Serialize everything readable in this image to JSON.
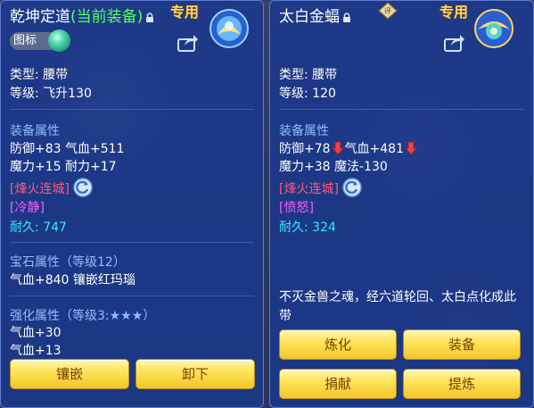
{
  "left_panel": {
    "title": "乾坤定道",
    "current_equip": "(当前装备)",
    "exclusive": "专用",
    "tag_label": "图标",
    "type_line": "类型: 腰带",
    "level_line": "等级: 飞升130",
    "attr_header": "装备属性",
    "attr_line1": "防御+83 气血+511",
    "attr_line2": "魔力+15 耐力+17",
    "special_skill": "[烽火连城]",
    "special_effect": "[冷静]",
    "durability": "耐久: 747",
    "gem_header": "宝石属性（等级12）",
    "gem_line": "气血+840 镶嵌红玛瑙",
    "enhance_header": "强化属性（等级3:★★★）",
    "enhance_line1": "气血+30",
    "enhance_line2": "气血+13",
    "buttons": {
      "inlay": "镶嵌",
      "unequip": "卸下"
    }
  },
  "right_panel": {
    "title": "太白金蝠",
    "exclusive": "专用",
    "type_line": "类型: 腰带",
    "level_line": "等级: 120",
    "attr_header": "装备属性",
    "attr_line1_a": "防御+78",
    "attr_line1_b": "气血+481",
    "attr_line2": "魔力+38 魔法-130",
    "special_skill": "[烽火连城]",
    "special_effect": "[愤怒]",
    "durability": "耐久: 324",
    "description": "不灭金兽之魂，经六道轮回、太白点化成此带",
    "buttons": {
      "refine": "炼化",
      "equip": "装备",
      "donate": "捐献",
      "extract": "提炼"
    }
  },
  "colors": {
    "panel_bg": "#1a388c",
    "section_header": "#8fbcff",
    "skill_red": "#ff5a78",
    "effect_magenta": "#f060ff",
    "durability_cyan": "#35e8ff",
    "current_equip_green": "#5dff5d",
    "exclusive_gold": "#ffd45a",
    "down_arrow": "#e8454a"
  },
  "icons": [
    "lock-icon",
    "equipment-badge-icon",
    "share-icon",
    "down-arrow-icon",
    "refresh-skill-icon",
    "appraise-diamond-icon"
  ]
}
